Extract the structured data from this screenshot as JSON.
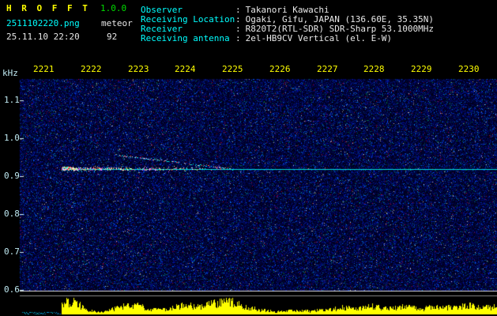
{
  "header": {
    "app_title": "H R O F F T",
    "version": "1.0.0",
    "filename": "2511102220.png",
    "mode": "meteor",
    "datetime": "25.11.10 22:20",
    "count": "92",
    "colon": ":",
    "info": [
      {
        "label": "Observer",
        "value": "Takanori Kawachi"
      },
      {
        "label": "Receiving Location",
        "value": "Ogaki, Gifu, JAPAN (136.60E, 35.35N)"
      },
      {
        "label": "Receiver",
        "value": "R820T2(RTL-SDR) SDR-Sharp 53.1000MHz"
      },
      {
        "label": "Receiving antenna",
        "value": "2el-HB9CV Vertical (el. E-W)"
      }
    ]
  },
  "spectrogram": {
    "freq_unit": "kHz",
    "time_labels": [
      "2221",
      "2222",
      "2223",
      "2224",
      "2225",
      "2226",
      "2227",
      "2228",
      "2229",
      "2230"
    ],
    "freq_labels": [
      "1.1",
      "1.0",
      "0.9",
      "0.8",
      "0.7",
      "0.6"
    ]
  },
  "colors": {
    "title_yellow": "#ffff00",
    "version_green": "#00dd00",
    "filename_cyan": "#00ffff",
    "info_label_cyan": "#00ffff",
    "text_white": "#e8e8e8",
    "time_label_yellow": "#ffff00",
    "freq_label": "#bfe9f2",
    "noise_blue": "#000050",
    "carrier": "#00dcdc",
    "histogram": "#ffff00"
  }
}
